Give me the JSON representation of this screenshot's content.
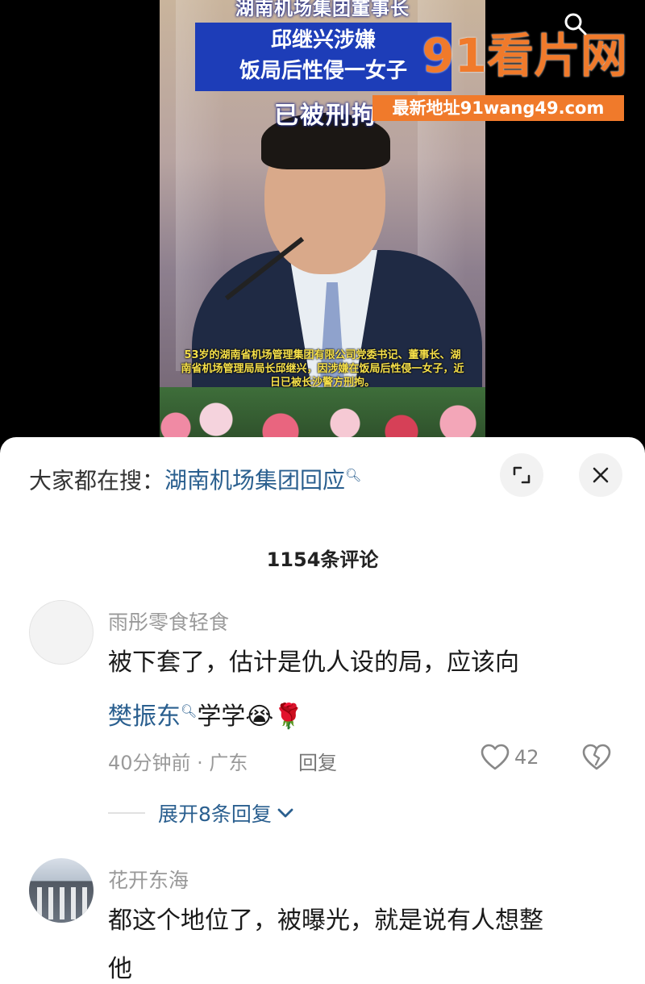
{
  "video": {
    "headline_top": "湖南机场集团董事长",
    "headline_box_line1": "邱继兴涉嫌",
    "headline_box_line2": "饭局后性侵一女子",
    "headline_bottom": "已被刑拘",
    "caption": "53岁的湖南省机场管理集团有限公司党委书记、董事长、湖南省机场管理局局长邱继兴，因涉嫌在饭局后性侵一女子，近日已被长沙警方刑拘。",
    "watermark": "91看片网",
    "watermark_url": "最新地址91wang49.com"
  },
  "sheet": {
    "search_prefix": "大家都在搜：",
    "search_term": "湖南机场集团回应",
    "comments_count": "1154条评论"
  },
  "comments": [
    {
      "username": "雨彤零食轻食",
      "text_line1": "被下套了，估计是仇人设的局，应该向",
      "mention": "樊振东",
      "text_tail": "学学😭🌹",
      "time_location": "40分钟前 · 广东",
      "reply_label": "回复",
      "likes": "42",
      "expand_replies": "展开8条回复"
    },
    {
      "username": "花开东海",
      "text_line1": "都这个地位了，被曝光，就是说有人想整",
      "text_line2": "他"
    }
  ],
  "colors": {
    "link_blue": "#2a5f8f",
    "headline_blue": "#1d3db8",
    "watermark_orange": "#f07a2b",
    "caption_yellow": "#f6e04a"
  },
  "icons": [
    "search-icon",
    "expand-icon",
    "close-icon",
    "heart-icon",
    "broken-heart-icon",
    "chevron-down-icon"
  ]
}
